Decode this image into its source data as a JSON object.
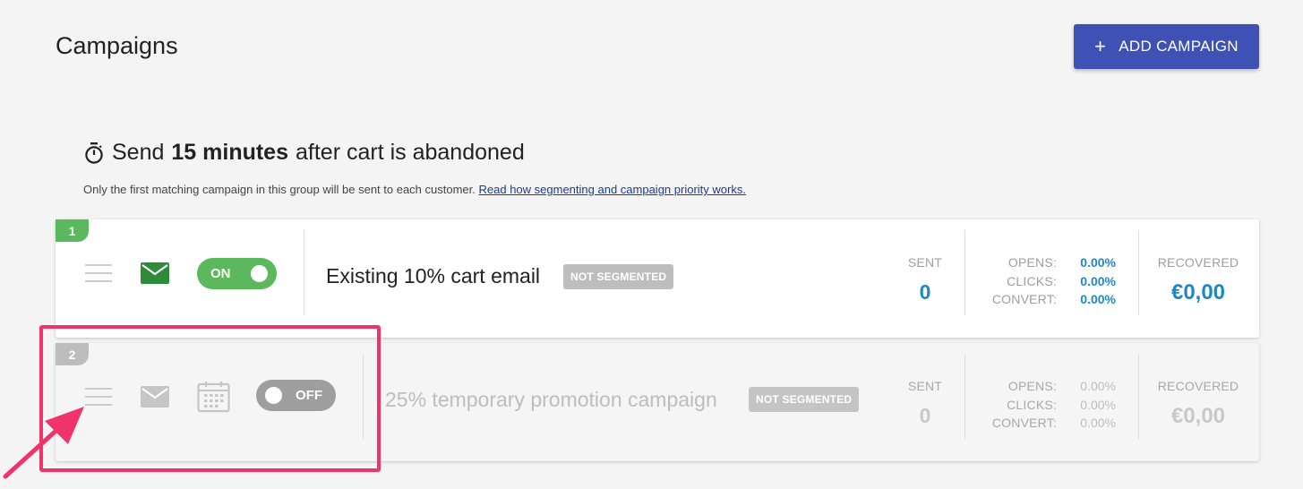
{
  "header": {
    "title": "Campaigns",
    "add_button_icon": "+",
    "add_button_label": "ADD CAMPAIGN"
  },
  "group": {
    "prefix": "Send",
    "delay": "15 minutes",
    "suffix": "after cart is abandoned",
    "note": "Only the first matching campaign in this group will be sent to each customer.",
    "note_link": "Read how segmenting and campaign priority works."
  },
  "campaigns": [
    {
      "priority": "1",
      "toggle": "ON",
      "name": "Existing 10% cart email",
      "segment": "NOT SEGMENTED",
      "sent_label": "SENT",
      "sent": "0",
      "opens_label": "OPENS:",
      "opens": "0.00%",
      "clicks_label": "CLICKS:",
      "clicks": "0.00%",
      "convert_label": "CONVERT:",
      "convert": "0.00%",
      "recovered_label": "RECOVERED",
      "recovered": "€0,00"
    },
    {
      "priority": "2",
      "toggle": "OFF",
      "name": "25% temporary promotion campaign",
      "segment": "NOT SEGMENTED",
      "sent_label": "SENT",
      "sent": "0",
      "opens_label": "OPENS:",
      "opens": "0.00%",
      "clicks_label": "CLICKS:",
      "clicks": "0.00%",
      "convert_label": "CONVERT:",
      "convert": "0.00%",
      "recovered_label": "RECOVERED",
      "recovered": "€0,00"
    }
  ],
  "colors": {
    "primary": "#3f51b5",
    "active_green": "#5cb85c",
    "stat_blue": "#1e88c7",
    "highlight": "#f0346b"
  },
  "icons": [
    "plus-icon",
    "stopwatch-icon",
    "drag-handle-icon",
    "mail-icon",
    "calendar-icon",
    "arrow-icon"
  ]
}
